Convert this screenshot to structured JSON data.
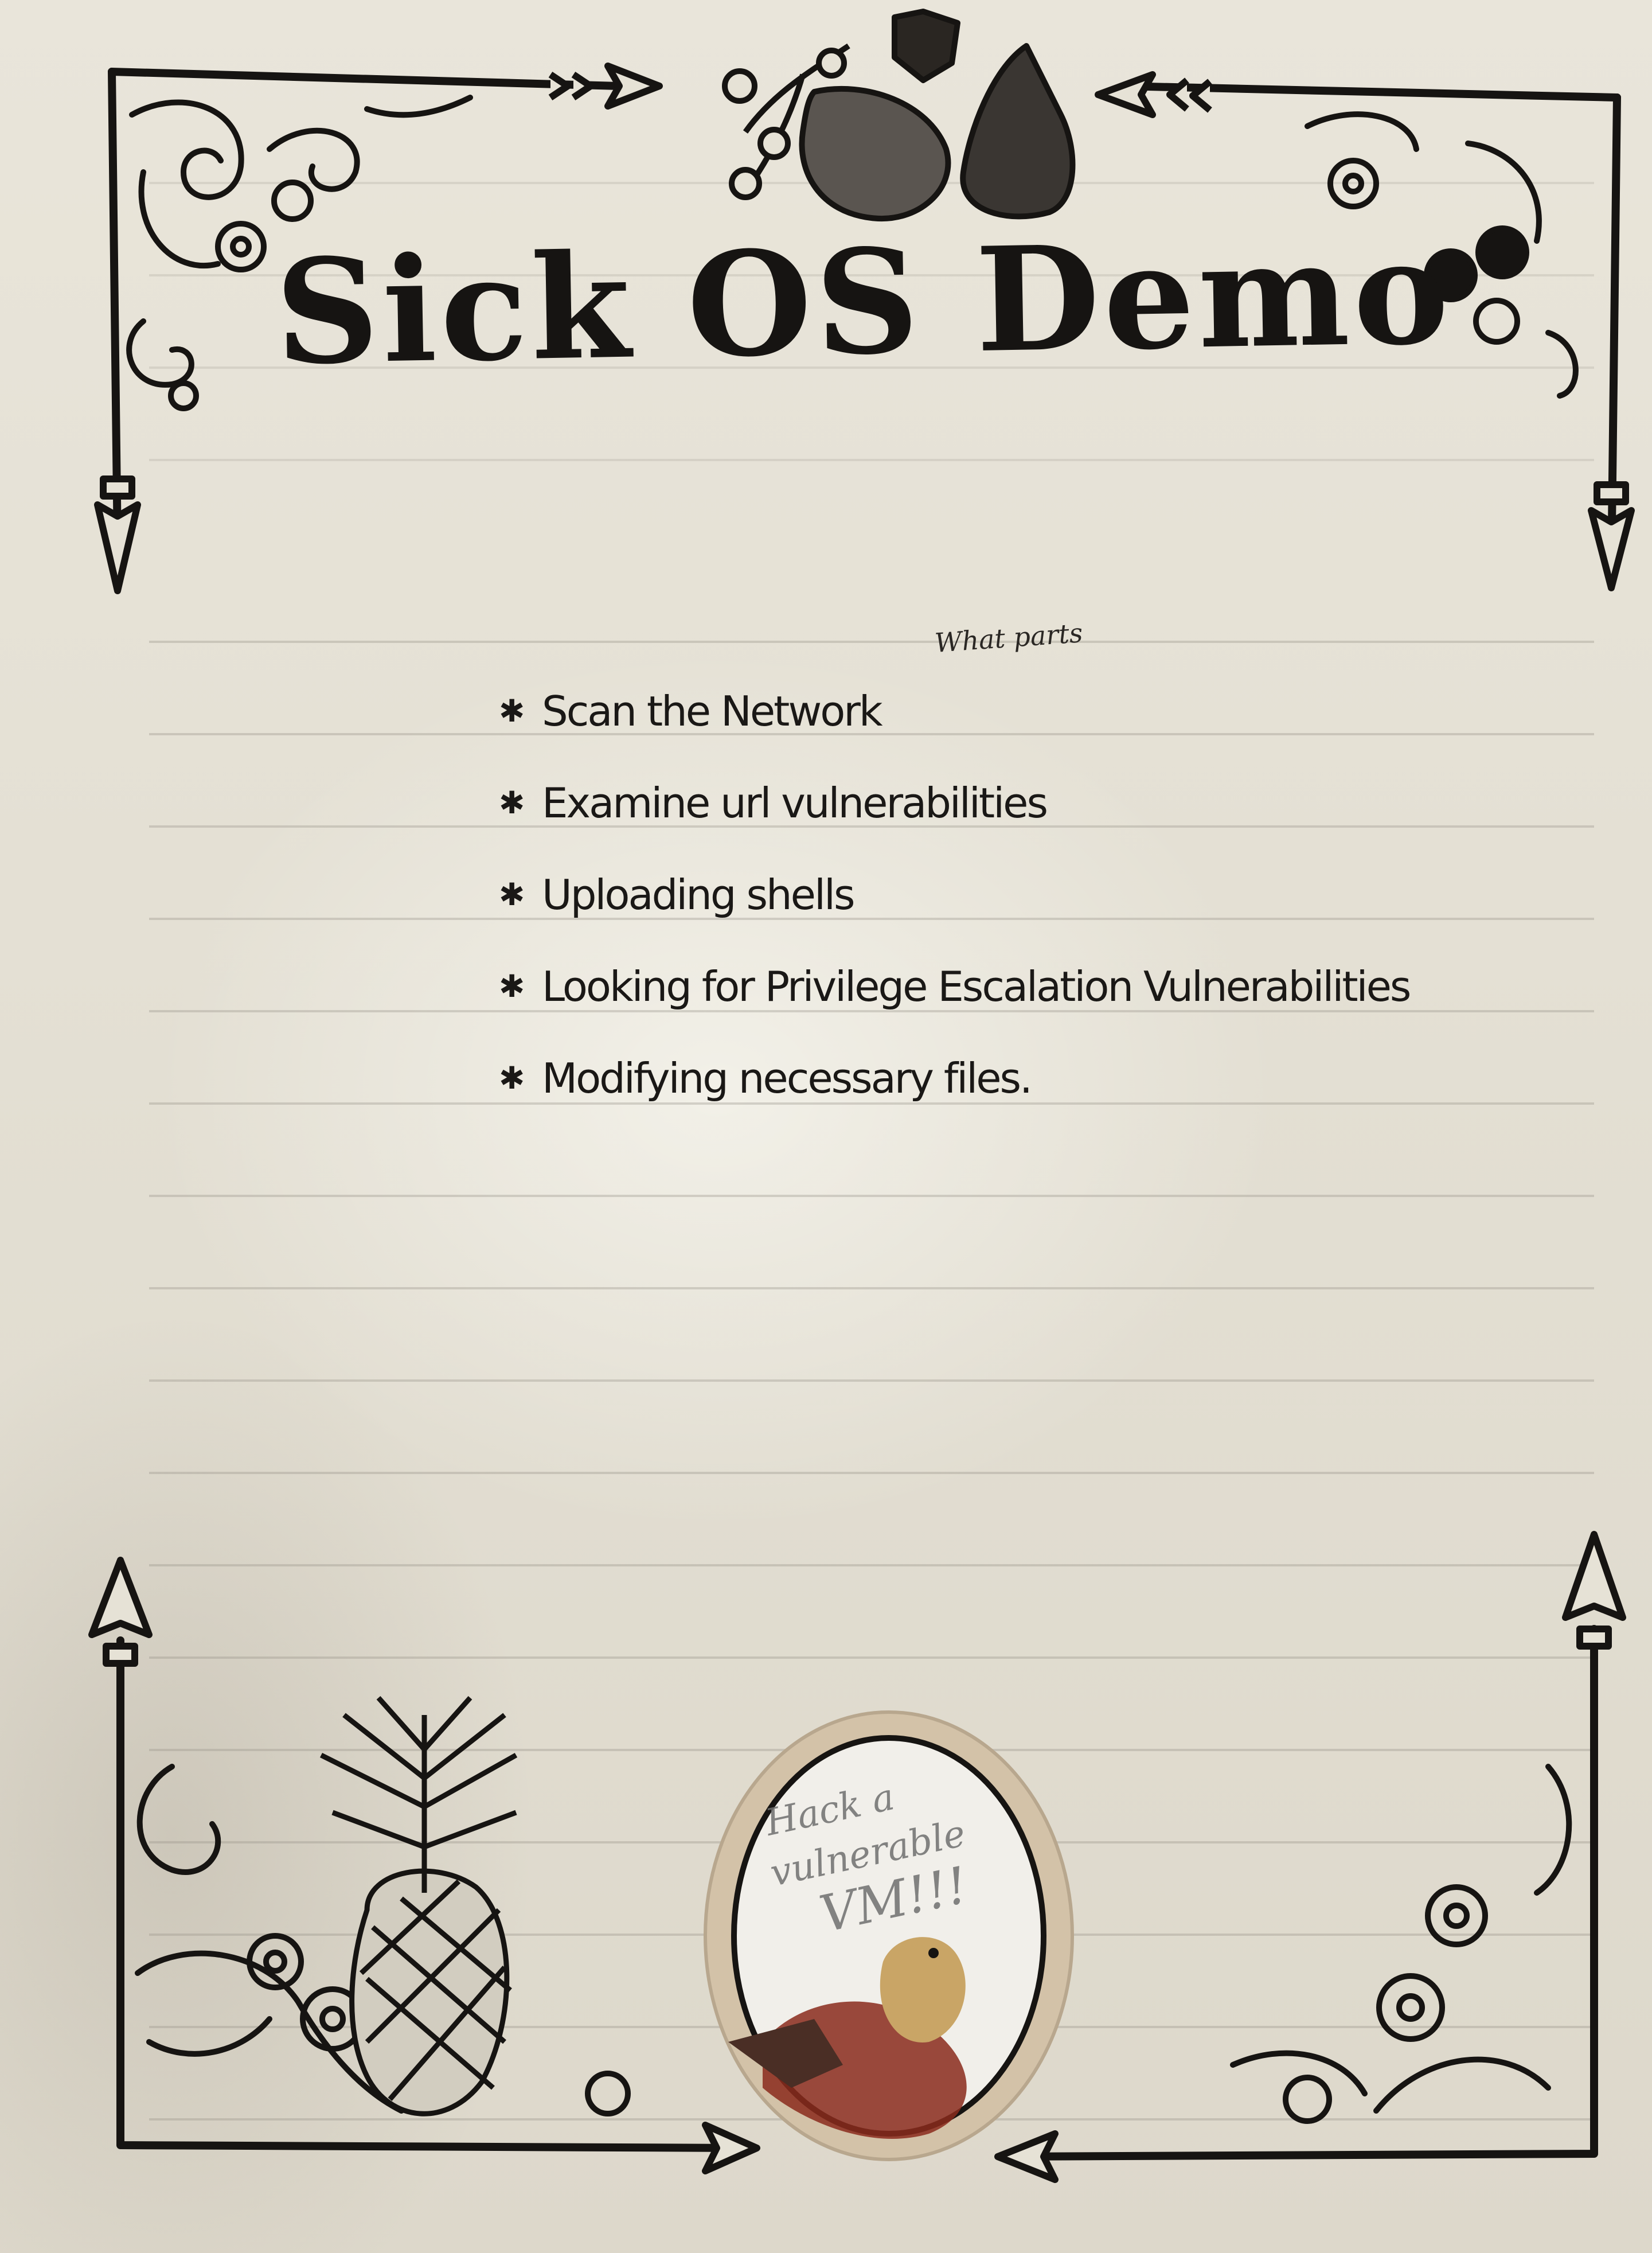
{
  "title": "Sick OS Demo",
  "margin_note": "What parts",
  "checklist": [
    "Scan the Network",
    "Examine url vulnerabilities",
    "Uploading shells",
    "Looking for Privilege Escalation Vulnerabilities",
    "Modifying necessary files."
  ],
  "sticker_note": {
    "line1": "Hack a",
    "line2": "vulnerable",
    "line3": "VM!!!"
  },
  "colors": {
    "paper": "#e6e2d6",
    "ink": "#161412",
    "sticker_ring": "#d3c2a8",
    "bird_red": "#8a2a1c",
    "bird_yellow": "#c9a566"
  },
  "icons": {
    "bullet": "star-bullet-icon",
    "arrow": "spear-arrow-icon",
    "fruit": "pear-icon",
    "plant": "pineapple-icon",
    "bird": "bird-icon"
  }
}
